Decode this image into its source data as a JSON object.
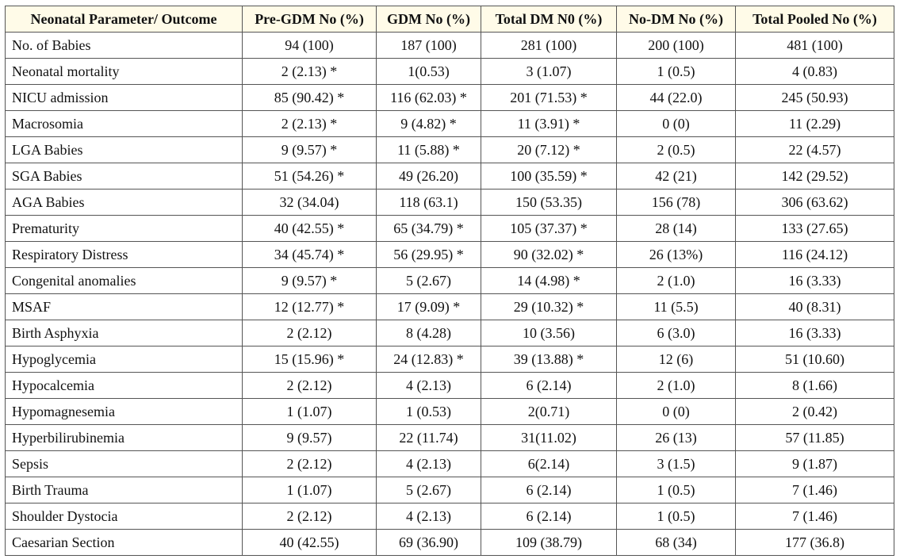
{
  "table": {
    "headers": [
      "Neonatal Parameter/ Outcome",
      "Pre-GDM No (%)",
      "GDM No (%)",
      "Total DM N0 (%)",
      "No-DM No (%)",
      "Total Pooled No (%)"
    ],
    "header_bg": "#fffbe8",
    "rows": [
      [
        "No. of Babies",
        "94 (100)",
        "187 (100)",
        "281 (100)",
        "200 (100)",
        "481 (100)"
      ],
      [
        "Neonatal mortality",
        "2 (2.13) *",
        "1(0.53)",
        "3 (1.07)",
        "1 (0.5)",
        "4 (0.83)"
      ],
      [
        "NICU admission",
        "85 (90.42) *",
        "116 (62.03) *",
        "201 (71.53) *",
        "44 (22.0)",
        "245 (50.93)"
      ],
      [
        "Macrosomia",
        "2 (2.13) *",
        "9 (4.82) *",
        "11 (3.91) *",
        "0 (0)",
        "11 (2.29)"
      ],
      [
        "LGA Babies",
        "9 (9.57) *",
        "11 (5.88) *",
        "20 (7.12) *",
        "2 (0.5)",
        "22 (4.57)"
      ],
      [
        "SGA Babies",
        "51 (54.26) *",
        "49 (26.20)",
        "100 (35.59) *",
        "42 (21)",
        "142 (29.52)"
      ],
      [
        "AGA Babies",
        "32 (34.04)",
        "118 (63.1)",
        "150 (53.35)",
        "156 (78)",
        "306 (63.62)"
      ],
      [
        "Prematurity",
        "40 (42.55) *",
        "65 (34.79) *",
        "105 (37.37) *",
        "28 (14)",
        "133 (27.65)"
      ],
      [
        "Respiratory Distress",
        "34 (45.74) *",
        "56 (29.95) *",
        "90 (32.02) *",
        "26 (13%)",
        "116 (24.12)"
      ],
      [
        "Congenital anomalies",
        "9 (9.57) *",
        "5 (2.67)",
        "14 (4.98) *",
        "2 (1.0)",
        "16 (3.33)"
      ],
      [
        "MSAF",
        "12 (12.77) *",
        "17 (9.09) *",
        "29 (10.32) *",
        "11 (5.5)",
        "40 (8.31)"
      ],
      [
        "Birth Asphyxia",
        "2 (2.12)",
        "8 (4.28)",
        "10 (3.56)",
        "6 (3.0)",
        "16 (3.33)"
      ],
      [
        "Hypoglycemia",
        "15 (15.96) *",
        "24 (12.83) *",
        "39 (13.88) *",
        "12 (6)",
        "51 (10.60)"
      ],
      [
        "Hypocalcemia",
        "2 (2.12)",
        "4 (2.13)",
        "6 (2.14)",
        "2 (1.0)",
        "8 (1.66)"
      ],
      [
        "Hypomagnesemia",
        "1 (1.07)",
        "1 (0.53)",
        "2(0.71)",
        "0 (0)",
        "2 (0.42)"
      ],
      [
        "Hyperbilirubinemia",
        "9 (9.57)",
        "22 (11.74)",
        "31(11.02)",
        "26 (13)",
        "57 (11.85)"
      ],
      [
        "Sepsis",
        "2 (2.12)",
        "4 (2.13)",
        "6(2.14)",
        "3 (1.5)",
        "9 (1.87)"
      ],
      [
        "Birth Trauma",
        "1 (1.07)",
        "5 (2.67)",
        "6 (2.14)",
        "1 (0.5)",
        "7 (1.46)"
      ],
      [
        "Shoulder Dystocia",
        "2 (2.12)",
        "4 (2.13)",
        "6 (2.14)",
        "1 (0.5)",
        "7 (1.46)"
      ],
      [
        "Caesarian Section",
        "40 (42.55)",
        "69 (36.90)",
        "109 (38.79)",
        "68 (34)",
        "177 (36.8)"
      ]
    ]
  }
}
